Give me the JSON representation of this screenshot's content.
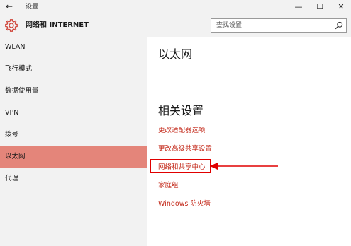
{
  "window": {
    "back_glyph": "←",
    "title": "设置",
    "minimize_glyph": "—",
    "maximize_glyph": "☐",
    "close_glyph": "✕"
  },
  "header": {
    "title": "网络和 INTERNET",
    "search_placeholder": "查找设置"
  },
  "sidebar": {
    "items": [
      {
        "label": "WLAN"
      },
      {
        "label": "飞行模式"
      },
      {
        "label": "数据使用量"
      },
      {
        "label": "VPN"
      },
      {
        "label": "拨号"
      },
      {
        "label": "以太网",
        "selected": true
      },
      {
        "label": "代理"
      }
    ]
  },
  "content": {
    "page_title": "以太网",
    "related_title": "相关设置",
    "links": [
      {
        "label": "更改适配器选项"
      },
      {
        "label": "更改高级共享设置"
      },
      {
        "label": "网络和共享中心",
        "highlighted": true
      },
      {
        "label": "家庭组"
      },
      {
        "label": "Windows 防火墙"
      }
    ]
  },
  "colors": {
    "accent": "#e4857a",
    "link": "#c42b1c",
    "highlight_box": "#e00000",
    "sidebar_bg": "#f2f2f2"
  },
  "icons": [
    "back-arrow-icon",
    "gear-icon",
    "search-icon",
    "red-arrow-annotation"
  ]
}
